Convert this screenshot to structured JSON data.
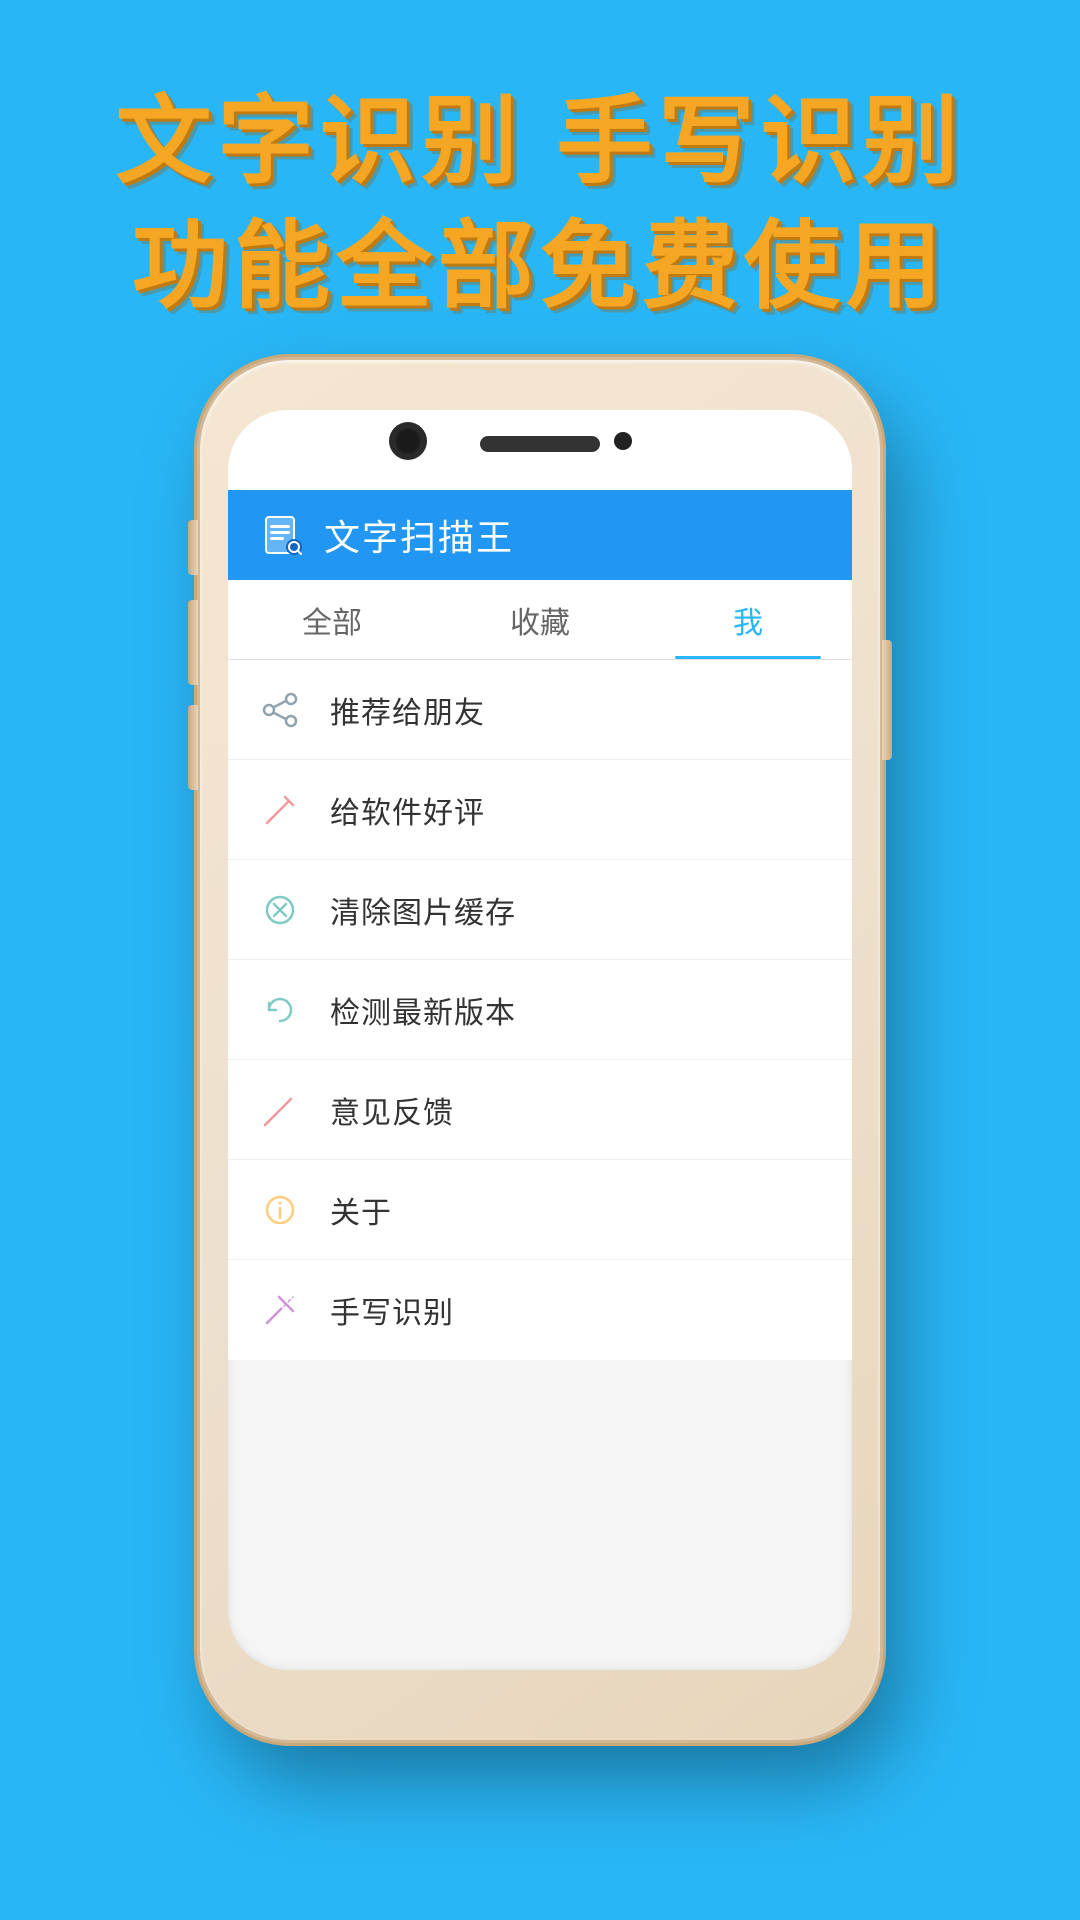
{
  "hero": {
    "line1": "文字识别  手写识别",
    "line2": "功能全部免费使用"
  },
  "app": {
    "title": "文字扫描王"
  },
  "tabs": [
    {
      "id": "all",
      "label": "全部",
      "active": false
    },
    {
      "id": "favorites",
      "label": "收藏",
      "active": false
    },
    {
      "id": "me",
      "label": "我",
      "active": true
    }
  ],
  "menu": [
    {
      "id": "recommend",
      "label": "推荐给朋友",
      "icon": "share"
    },
    {
      "id": "rate",
      "label": "给软件好评",
      "icon": "pen"
    },
    {
      "id": "clear-cache",
      "label": "清除图片缓存",
      "icon": "clear"
    },
    {
      "id": "check-update",
      "label": "检测最新版本",
      "icon": "refresh"
    },
    {
      "id": "feedback",
      "label": "意见反馈",
      "icon": "feedback"
    },
    {
      "id": "about",
      "label": "关于",
      "icon": "info"
    },
    {
      "id": "handwrite",
      "label": "手写识别",
      "icon": "handwrite"
    }
  ]
}
